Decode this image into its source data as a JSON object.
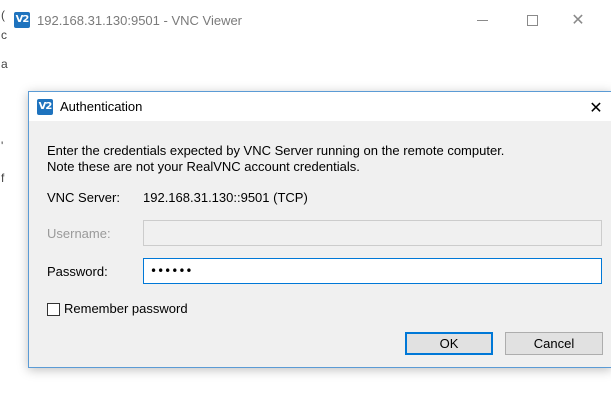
{
  "main_window": {
    "title": "192.168.31.130:9501 - VNC Viewer",
    "logo_text": "V2",
    "logo_color": "#1e73be",
    "edge_marks": [
      "(",
      "c",
      "a",
      "'",
      "f"
    ]
  },
  "dialog": {
    "title": "Authentication",
    "description_line1": "Enter the credentials expected by VNC Server running on the remote computer.",
    "description_line2": "Note these are not your RealVNC account credentials.",
    "server_label": "VNC Server:",
    "server_value": "192.168.31.130::9501 (TCP)",
    "username_label": "Username:",
    "username_value": "",
    "password_label": "Password:",
    "password_value": "••••••",
    "remember_label": "Remember password",
    "remember_checked": false,
    "ok_label": "OK",
    "cancel_label": "Cancel",
    "accent_color": "#0078d7"
  }
}
